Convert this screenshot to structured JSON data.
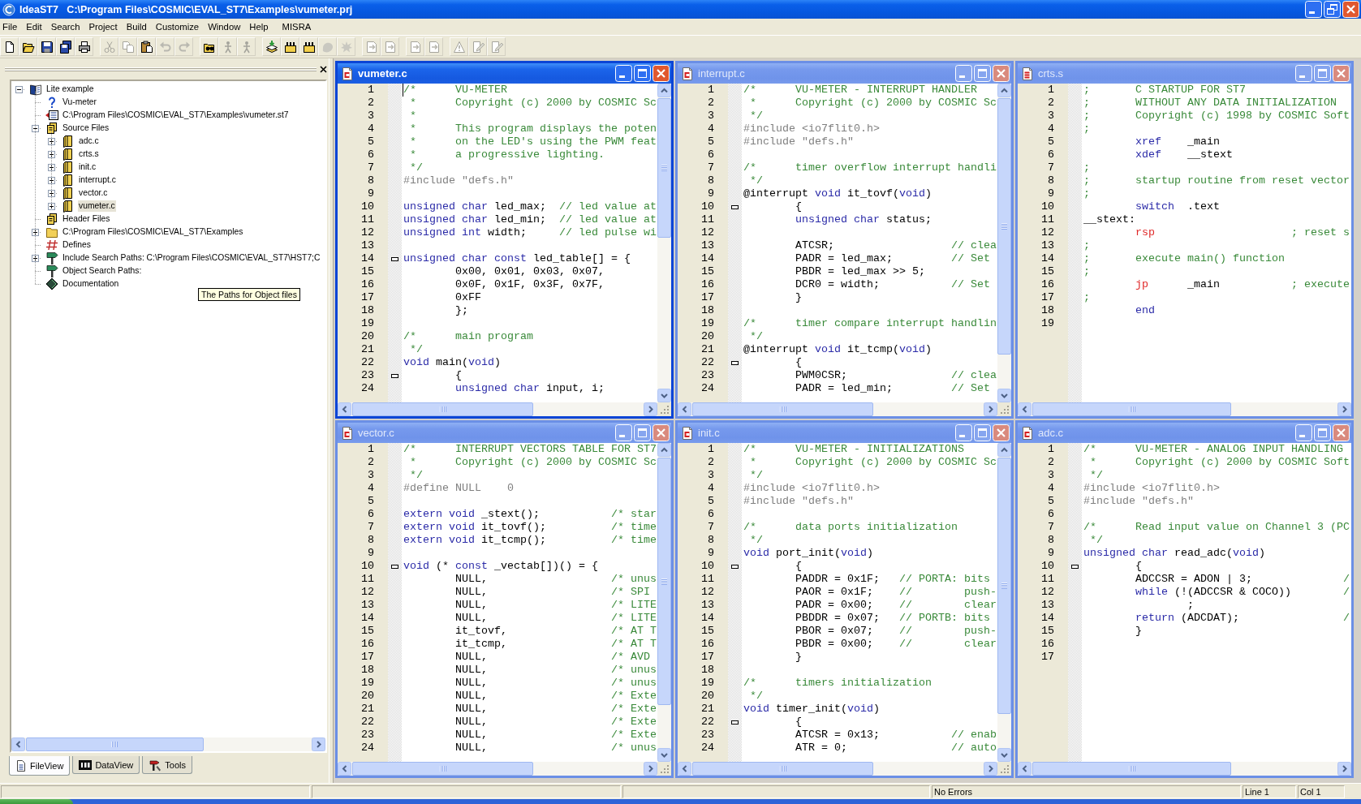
{
  "window": {
    "title": "IdeaST7   C:\\Program Files\\COSMIC\\EVAL_ST7\\Examples\\vumeter.prj"
  },
  "menu": [
    "File",
    "Edit",
    "Search",
    "Project",
    "Build",
    "Customize",
    "Window",
    "Help",
    "MISRA"
  ],
  "toolbar": [
    [
      {
        "kind": "new",
        "disabled": false
      },
      {
        "kind": "open",
        "disabled": false
      },
      {
        "kind": "save",
        "disabled": false
      },
      {
        "kind": "saveall",
        "disabled": false
      },
      {
        "kind": "print",
        "disabled": false
      }
    ],
    [
      {
        "kind": "cut",
        "disabled": true
      },
      {
        "kind": "copy",
        "disabled": true
      },
      {
        "kind": "paste",
        "disabled": false
      },
      {
        "kind": "undo",
        "disabled": true
      },
      {
        "kind": "redo",
        "disabled": true
      }
    ],
    [
      {
        "kind": "find",
        "disabled": false
      },
      {
        "kind": "figure",
        "disabled": true
      },
      {
        "kind": "figure",
        "disabled": true
      }
    ],
    [
      {
        "kind": "stack",
        "disabled": false
      },
      {
        "kind": "comb",
        "disabled": false
      },
      {
        "kind": "comb",
        "disabled": false
      },
      {
        "kind": "blob",
        "disabled": true
      },
      {
        "kind": "splat",
        "disabled": true
      }
    ],
    [
      {
        "kind": "errnav",
        "disabled": true
      },
      {
        "kind": "errnav",
        "disabled": true
      }
    ],
    [
      {
        "kind": "errnav",
        "disabled": true
      },
      {
        "kind": "errnav",
        "disabled": true
      }
    ],
    [
      {
        "kind": "triangle",
        "disabled": true
      },
      {
        "kind": "pencil",
        "disabled": true
      },
      {
        "kind": "pencil",
        "disabled": true
      }
    ]
  ],
  "workspace": {
    "tree": [
      {
        "label": "Lite example",
        "kind": "project",
        "expanded": true,
        "selected": false,
        "children": [
          {
            "label": "Vu-meter",
            "kind": "help",
            "selected": false
          },
          {
            "label": "C:\\Program Files\\COSMIC\\EVAL_ST7\\Examples\\vumeter.st7",
            "kind": "target",
            "selected": false
          },
          {
            "label": "Source Files",
            "kind": "group",
            "expanded": true,
            "selected": false,
            "children": [
              {
                "label": "adc.c",
                "kind": "source",
                "expanded": false,
                "selected": false
              },
              {
                "label": "crts.s",
                "kind": "source",
                "expanded": false,
                "selected": false
              },
              {
                "label": "init.c",
                "kind": "source",
                "expanded": false,
                "selected": false
              },
              {
                "label": "interrupt.c",
                "kind": "source",
                "expanded": false,
                "selected": false
              },
              {
                "label": "vector.c",
                "kind": "source",
                "expanded": false,
                "selected": false
              },
              {
                "label": "vumeter.c",
                "kind": "source",
                "expanded": false,
                "selected": true
              }
            ]
          },
          {
            "label": "Header Files",
            "kind": "group",
            "selected": false
          },
          {
            "label": "C:\\Program Files\\COSMIC\\EVAL_ST7\\Examples",
            "kind": "folder",
            "expanded": false,
            "selected": false
          },
          {
            "label": "Defines",
            "kind": "defines",
            "selected": false
          },
          {
            "label": "Include Search Paths: C:\\Program Files\\COSMIC\\EVAL_ST7\\HST7;C",
            "kind": "paths",
            "expanded": false,
            "selected": false
          },
          {
            "label": "Object Search Paths:",
            "kind": "paths",
            "selected": false
          },
          {
            "label": "Documentation",
            "kind": "docs",
            "selected": false
          }
        ]
      }
    ],
    "tooltip": "The Paths for Object files",
    "tabs": [
      {
        "label": "FileView",
        "kind": "file",
        "selected": true
      },
      {
        "label": "DataView",
        "kind": "data",
        "selected": false
      },
      {
        "label": "Tools",
        "kind": "tools",
        "selected": false
      }
    ]
  },
  "editors": [
    {
      "title": "vumeter.c",
      "kind": "csource",
      "active": true,
      "lines": [
        {
          "number": "1",
          "fold": false,
          "code": [
            {
              "kind": "comment",
              "text": "/*      VU-METER"
            }
          ]
        },
        {
          "number": "2",
          "fold": false,
          "code": [
            {
              "kind": "comment",
              "text": " *      Copyright (c) 2000 by COSMIC Sc"
            }
          ]
        },
        {
          "number": "3",
          "fold": false,
          "code": [
            {
              "kind": "comment",
              "text": " *"
            }
          ]
        },
        {
          "number": "4",
          "fold": false,
          "code": [
            {
              "kind": "comment",
              "text": " *      This program displays the poten"
            }
          ]
        },
        {
          "number": "5",
          "fold": false,
          "code": [
            {
              "kind": "comment",
              "text": " *      on the LED's using the PWM feat"
            }
          ]
        },
        {
          "number": "6",
          "fold": false,
          "code": [
            {
              "kind": "comment",
              "text": " *      a progressive lighting."
            }
          ]
        },
        {
          "number": "7",
          "fold": false,
          "code": [
            {
              "kind": "comment",
              "text": " */"
            }
          ]
        },
        {
          "number": "8",
          "fold": false,
          "code": [
            {
              "kind": "preprocessor",
              "text": "#include \"defs.h\""
            }
          ]
        },
        {
          "number": "9",
          "fold": false
        },
        {
          "number": "10",
          "fold": false,
          "code": [
            {
              "kind": "keyword",
              "text": "unsigned char"
            },
            {
              "kind": "plain",
              "text": " led_max;  "
            },
            {
              "kind": "comment",
              "text": "// led value at"
            }
          ]
        },
        {
          "number": "11",
          "fold": false,
          "code": [
            {
              "kind": "keyword",
              "text": "unsigned char"
            },
            {
              "kind": "plain",
              "text": " led_min;  "
            },
            {
              "kind": "comment",
              "text": "// led value at"
            }
          ]
        },
        {
          "number": "12",
          "fold": false,
          "code": [
            {
              "kind": "keyword",
              "text": "unsigned int"
            },
            {
              "kind": "plain",
              "text": " width;     "
            },
            {
              "kind": "comment",
              "text": "// led pulse wi"
            }
          ]
        },
        {
          "number": "13",
          "fold": false
        },
        {
          "number": "14",
          "fold": true,
          "code": [
            {
              "kind": "keyword",
              "text": "unsigned char const"
            },
            {
              "kind": "plain",
              "text": " led_table[] = {"
            }
          ]
        },
        {
          "number": "15",
          "fold": false,
          "code": [
            {
              "kind": "plain",
              "text": "        0x00, 0x01, 0x03, 0x07,"
            }
          ]
        },
        {
          "number": "16",
          "fold": false,
          "code": [
            {
              "kind": "plain",
              "text": "        0x0F, 0x1F, 0x3F, 0x7F,"
            }
          ]
        },
        {
          "number": "17",
          "fold": false,
          "code": [
            {
              "kind": "plain",
              "text": "        0xFF"
            }
          ]
        },
        {
          "number": "18",
          "fold": false,
          "code": [
            {
              "kind": "plain",
              "text": "        };"
            }
          ]
        },
        {
          "number": "19",
          "fold": false
        },
        {
          "number": "20",
          "fold": false,
          "code": [
            {
              "kind": "comment",
              "text": "/*      main program"
            }
          ]
        },
        {
          "number": "21",
          "fold": false,
          "code": [
            {
              "kind": "comment",
              "text": " */"
            }
          ]
        },
        {
          "number": "22",
          "fold": false,
          "code": [
            {
              "kind": "keyword",
              "text": "void"
            },
            {
              "kind": "plain",
              "text": " main("
            },
            {
              "kind": "keyword",
              "text": "void"
            },
            {
              "kind": "plain",
              "text": ")"
            }
          ]
        },
        {
          "number": "23",
          "fold": true,
          "code": [
            {
              "kind": "plain",
              "text": "        {"
            }
          ]
        },
        {
          "number": "24",
          "fold": false,
          "code": [
            {
              "kind": "keyword",
              "text": "        unsigned char"
            },
            {
              "kind": "plain",
              "text": " input, i;"
            }
          ]
        }
      ]
    },
    {
      "title": "interrupt.c",
      "kind": "csource",
      "active": false,
      "lines": [
        {
          "number": "1",
          "fold": false,
          "code": [
            {
              "kind": "comment",
              "text": "/*      VU-METER - INTERRUPT HANDLER"
            }
          ]
        },
        {
          "number": "2",
          "fold": false,
          "code": [
            {
              "kind": "comment",
              "text": " *      Copyright (c) 2000 by COSMIC Sc"
            }
          ]
        },
        {
          "number": "3",
          "fold": false,
          "code": [
            {
              "kind": "comment",
              "text": " */"
            }
          ]
        },
        {
          "number": "4",
          "fold": false,
          "code": [
            {
              "kind": "preprocessor",
              "text": "#include <io7flit0.h>"
            }
          ]
        },
        {
          "number": "5",
          "fold": false,
          "code": [
            {
              "kind": "preprocessor",
              "text": "#include \"defs.h\""
            }
          ]
        },
        {
          "number": "6",
          "fold": false
        },
        {
          "number": "7",
          "fold": false,
          "code": [
            {
              "kind": "comment",
              "text": "/*      timer overflow interrupt handli"
            }
          ]
        },
        {
          "number": "8",
          "fold": false,
          "code": [
            {
              "kind": "comment",
              "text": " */"
            }
          ]
        },
        {
          "number": "9",
          "fold": false,
          "code": [
            {
              "kind": "plain",
              "text": "@interrupt "
            },
            {
              "kind": "keyword",
              "text": "void"
            },
            {
              "kind": "plain",
              "text": " it_tovf("
            },
            {
              "kind": "keyword",
              "text": "void"
            },
            {
              "kind": "plain",
              "text": ")"
            }
          ]
        },
        {
          "number": "10",
          "fold": true,
          "code": [
            {
              "kind": "plain",
              "text": "        {"
            }
          ]
        },
        {
          "number": "11",
          "fold": false,
          "code": [
            {
              "kind": "keyword",
              "text": "        unsigned char"
            },
            {
              "kind": "plain",
              "text": " status;"
            }
          ]
        },
        {
          "number": "12",
          "fold": false
        },
        {
          "number": "13",
          "fold": false,
          "code": [
            {
              "kind": "plain",
              "text": "        ATCSR;                  "
            },
            {
              "kind": "comment",
              "text": "// clea"
            }
          ]
        },
        {
          "number": "14",
          "fold": false,
          "code": [
            {
              "kind": "plain",
              "text": "        PADR = led_max;         "
            },
            {
              "kind": "comment",
              "text": "// Set"
            }
          ]
        },
        {
          "number": "15",
          "fold": false,
          "code": [
            {
              "kind": "plain",
              "text": "        PBDR = led_max >> 5;"
            }
          ]
        },
        {
          "number": "16",
          "fold": false,
          "code": [
            {
              "kind": "plain",
              "text": "        DCR0 = width;           "
            },
            {
              "kind": "comment",
              "text": "// Set"
            }
          ]
        },
        {
          "number": "17",
          "fold": false,
          "code": [
            {
              "kind": "plain",
              "text": "        }"
            }
          ]
        },
        {
          "number": "18",
          "fold": false
        },
        {
          "number": "19",
          "fold": false,
          "code": [
            {
              "kind": "comment",
              "text": "/*      timer compare interrupt handlin"
            }
          ]
        },
        {
          "number": "20",
          "fold": false,
          "code": [
            {
              "kind": "comment",
              "text": " */"
            }
          ]
        },
        {
          "number": "21",
          "fold": false,
          "code": [
            {
              "kind": "plain",
              "text": "@interrupt "
            },
            {
              "kind": "keyword",
              "text": "void"
            },
            {
              "kind": "plain",
              "text": " it_tcmp("
            },
            {
              "kind": "keyword",
              "text": "void"
            },
            {
              "kind": "plain",
              "text": ")"
            }
          ]
        },
        {
          "number": "22",
          "fold": true,
          "code": [
            {
              "kind": "plain",
              "text": "        {"
            }
          ]
        },
        {
          "number": "23",
          "fold": false,
          "code": [
            {
              "kind": "plain",
              "text": "        PWM0CSR;                "
            },
            {
              "kind": "comment",
              "text": "// clea"
            }
          ]
        },
        {
          "number": "24",
          "fold": false,
          "code": [
            {
              "kind": "plain",
              "text": "        PADR = led_min;         "
            },
            {
              "kind": "comment",
              "text": "// Set"
            }
          ]
        }
      ]
    },
    {
      "title": "crts.s",
      "kind": "assembly",
      "active": false,
      "lines": [
        {
          "number": "1",
          "fold": false,
          "code": [
            {
              "kind": "comment",
              "text": ";       C STARTUP FOR ST7"
            }
          ]
        },
        {
          "number": "2",
          "fold": false,
          "code": [
            {
              "kind": "comment",
              "text": ";       WITHOUT ANY DATA INITIALIZATION"
            }
          ]
        },
        {
          "number": "3",
          "fold": false,
          "code": [
            {
              "kind": "comment",
              "text": ";       Copyright (c) 1998 by COSMIC Soft"
            }
          ]
        },
        {
          "number": "4",
          "fold": false,
          "code": [
            {
              "kind": "comment",
              "text": ";"
            }
          ]
        },
        {
          "number": "5",
          "fold": false,
          "code": [
            {
              "kind": "keyword",
              "text": "        xref"
            },
            {
              "kind": "plain",
              "text": "    _main"
            }
          ]
        },
        {
          "number": "6",
          "fold": false,
          "code": [
            {
              "kind": "keyword",
              "text": "        xdef"
            },
            {
              "kind": "plain",
              "text": "    __stext"
            }
          ]
        },
        {
          "number": "7",
          "fold": false,
          "code": [
            {
              "kind": "comment",
              "text": ";"
            }
          ]
        },
        {
          "number": "8",
          "fold": false,
          "code": [
            {
              "kind": "comment",
              "text": ";       startup routine from reset vector"
            }
          ]
        },
        {
          "number": "9",
          "fold": false,
          "code": [
            {
              "kind": "comment",
              "text": ";"
            }
          ]
        },
        {
          "number": "10",
          "fold": false,
          "code": [
            {
              "kind": "keyword",
              "text": "        switch"
            },
            {
              "kind": "plain",
              "text": "  .text"
            }
          ]
        },
        {
          "number": "11",
          "fold": false,
          "code": [
            {
              "kind": "plain",
              "text": "__stext:"
            }
          ]
        },
        {
          "number": "12",
          "fold": false,
          "code": [
            {
              "kind": "instruction",
              "text": "        rsp"
            },
            {
              "kind": "comment",
              "text": "                     ; reset s"
            }
          ]
        },
        {
          "number": "13",
          "fold": false,
          "code": [
            {
              "kind": "comment",
              "text": ";"
            }
          ]
        },
        {
          "number": "14",
          "fold": false,
          "code": [
            {
              "kind": "comment",
              "text": ";       execute main() function"
            }
          ]
        },
        {
          "number": "15",
          "fold": false,
          "code": [
            {
              "kind": "comment",
              "text": ";"
            }
          ]
        },
        {
          "number": "16",
          "fold": false,
          "code": [
            {
              "kind": "instruction",
              "text": "        jp"
            },
            {
              "kind": "plain",
              "text": "      _main           "
            },
            {
              "kind": "comment",
              "text": "; execute"
            }
          ]
        },
        {
          "number": "17",
          "fold": false,
          "code": [
            {
              "kind": "comment",
              "text": ";"
            }
          ]
        },
        {
          "number": "18",
          "fold": false,
          "code": [
            {
              "kind": "keyword",
              "text": "        end"
            }
          ]
        },
        {
          "number": "19",
          "fold": false
        }
      ]
    },
    {
      "title": "vector.c",
      "kind": "csource",
      "active": false,
      "lines": [
        {
          "number": "1",
          "fold": false,
          "code": [
            {
              "kind": "comment",
              "text": "/*      INTERRUPT VECTORS TABLE FOR ST7"
            }
          ]
        },
        {
          "number": "2",
          "fold": false,
          "code": [
            {
              "kind": "comment",
              "text": " *      Copyright (c) 2000 by COSMIC Sc"
            }
          ]
        },
        {
          "number": "3",
          "fold": false,
          "code": [
            {
              "kind": "comment",
              "text": " */"
            }
          ]
        },
        {
          "number": "4",
          "fold": false,
          "code": [
            {
              "kind": "preprocessor",
              "text": "#define NULL    0"
            }
          ]
        },
        {
          "number": "5",
          "fold": false
        },
        {
          "number": "6",
          "fold": false,
          "code": [
            {
              "kind": "keyword",
              "text": "extern void"
            },
            {
              "kind": "plain",
              "text": " _stext();           "
            },
            {
              "kind": "comment",
              "text": "/* star"
            }
          ]
        },
        {
          "number": "7",
          "fold": false,
          "code": [
            {
              "kind": "keyword",
              "text": "extern void"
            },
            {
              "kind": "plain",
              "text": " it_tovf();          "
            },
            {
              "kind": "comment",
              "text": "/* time"
            }
          ]
        },
        {
          "number": "8",
          "fold": false,
          "code": [
            {
              "kind": "keyword",
              "text": "extern void"
            },
            {
              "kind": "plain",
              "text": " it_tcmp();          "
            },
            {
              "kind": "comment",
              "text": "/* time"
            }
          ]
        },
        {
          "number": "9",
          "fold": false
        },
        {
          "number": "10",
          "fold": true,
          "code": [
            {
              "kind": "keyword",
              "text": "void"
            },
            {
              "kind": "plain",
              "text": " (* "
            },
            {
              "kind": "keyword",
              "text": "const"
            },
            {
              "kind": "plain",
              "text": " _vectab[])() = {"
            }
          ]
        },
        {
          "number": "11",
          "fold": false,
          "code": [
            {
              "kind": "plain",
              "text": "        NULL,                   "
            },
            {
              "kind": "comment",
              "text": "/* unus"
            }
          ]
        },
        {
          "number": "12",
          "fold": false,
          "code": [
            {
              "kind": "plain",
              "text": "        NULL,                   "
            },
            {
              "kind": "comment",
              "text": "/* SPI"
            }
          ]
        },
        {
          "number": "13",
          "fold": false,
          "code": [
            {
              "kind": "plain",
              "text": "        NULL,                   "
            },
            {
              "kind": "comment",
              "text": "/* LITE"
            }
          ]
        },
        {
          "number": "14",
          "fold": false,
          "code": [
            {
              "kind": "plain",
              "text": "        NULL,                   "
            },
            {
              "kind": "comment",
              "text": "/* LITE"
            }
          ]
        },
        {
          "number": "15",
          "fold": false,
          "code": [
            {
              "kind": "plain",
              "text": "        it_tovf,                "
            },
            {
              "kind": "comment",
              "text": "/* AT T"
            }
          ]
        },
        {
          "number": "16",
          "fold": false,
          "code": [
            {
              "kind": "plain",
              "text": "        it_tcmp,                "
            },
            {
              "kind": "comment",
              "text": "/* AT T"
            }
          ]
        },
        {
          "number": "17",
          "fold": false,
          "code": [
            {
              "kind": "plain",
              "text": "        NULL,                   "
            },
            {
              "kind": "comment",
              "text": "/* AVD"
            }
          ]
        },
        {
          "number": "18",
          "fold": false,
          "code": [
            {
              "kind": "plain",
              "text": "        NULL,                   "
            },
            {
              "kind": "comment",
              "text": "/* unus"
            }
          ]
        },
        {
          "number": "19",
          "fold": false,
          "code": [
            {
              "kind": "plain",
              "text": "        NULL,                   "
            },
            {
              "kind": "comment",
              "text": "/* unus"
            }
          ]
        },
        {
          "number": "20",
          "fold": false,
          "code": [
            {
              "kind": "plain",
              "text": "        NULL,                   "
            },
            {
              "kind": "comment",
              "text": "/* Exte"
            }
          ]
        },
        {
          "number": "21",
          "fold": false,
          "code": [
            {
              "kind": "plain",
              "text": "        NULL,                   "
            },
            {
              "kind": "comment",
              "text": "/* Exte"
            }
          ]
        },
        {
          "number": "22",
          "fold": false,
          "code": [
            {
              "kind": "plain",
              "text": "        NULL,                   "
            },
            {
              "kind": "comment",
              "text": "/* Exte"
            }
          ]
        },
        {
          "number": "23",
          "fold": false,
          "code": [
            {
              "kind": "plain",
              "text": "        NULL,                   "
            },
            {
              "kind": "comment",
              "text": "/* Exte"
            }
          ]
        },
        {
          "number": "24",
          "fold": false,
          "code": [
            {
              "kind": "plain",
              "text": "        NULL,                   "
            },
            {
              "kind": "comment",
              "text": "/* unus"
            }
          ]
        }
      ]
    },
    {
      "title": "init.c",
      "kind": "csource",
      "active": false,
      "lines": [
        {
          "number": "1",
          "fold": false,
          "code": [
            {
              "kind": "comment",
              "text": "/*      VU-METER - INITIALIZATIONS"
            }
          ]
        },
        {
          "number": "2",
          "fold": false,
          "code": [
            {
              "kind": "comment",
              "text": " *      Copyright (c) 2000 by COSMIC Sc"
            }
          ]
        },
        {
          "number": "3",
          "fold": false,
          "code": [
            {
              "kind": "comment",
              "text": " */"
            }
          ]
        },
        {
          "number": "4",
          "fold": false,
          "code": [
            {
              "kind": "preprocessor",
              "text": "#include <io7flit0.h>"
            }
          ]
        },
        {
          "number": "5",
          "fold": false,
          "code": [
            {
              "kind": "preprocessor",
              "text": "#include \"defs.h\""
            }
          ]
        },
        {
          "number": "6",
          "fold": false
        },
        {
          "number": "7",
          "fold": false,
          "code": [
            {
              "kind": "comment",
              "text": "/*      data ports initialization"
            }
          ]
        },
        {
          "number": "8",
          "fold": false,
          "code": [
            {
              "kind": "comment",
              "text": " */"
            }
          ]
        },
        {
          "number": "9",
          "fold": false,
          "code": [
            {
              "kind": "keyword",
              "text": "void"
            },
            {
              "kind": "plain",
              "text": " port_init("
            },
            {
              "kind": "keyword",
              "text": "void"
            },
            {
              "kind": "plain",
              "text": ")"
            }
          ]
        },
        {
          "number": "10",
          "fold": true,
          "code": [
            {
              "kind": "plain",
              "text": "        {"
            }
          ]
        },
        {
          "number": "11",
          "fold": false,
          "code": [
            {
              "kind": "plain",
              "text": "        PADDR = 0x1F;   "
            },
            {
              "kind": "comment",
              "text": "// PORTA: bits"
            }
          ]
        },
        {
          "number": "12",
          "fold": false,
          "code": [
            {
              "kind": "plain",
              "text": "        PAOR = 0x1F;    "
            },
            {
              "kind": "comment",
              "text": "//        push-"
            }
          ]
        },
        {
          "number": "13",
          "fold": false,
          "code": [
            {
              "kind": "plain",
              "text": "        PADR = 0x00;    "
            },
            {
              "kind": "comment",
              "text": "//        clear"
            }
          ]
        },
        {
          "number": "14",
          "fold": false,
          "code": [
            {
              "kind": "plain",
              "text": "        PBDDR = 0x07;   "
            },
            {
              "kind": "comment",
              "text": "// PORTB: bits"
            }
          ]
        },
        {
          "number": "15",
          "fold": false,
          "code": [
            {
              "kind": "plain",
              "text": "        PBOR = 0x07;    "
            },
            {
              "kind": "comment",
              "text": "//        push-"
            }
          ]
        },
        {
          "number": "16",
          "fold": false,
          "code": [
            {
              "kind": "plain",
              "text": "        PBDR = 0x00;    "
            },
            {
              "kind": "comment",
              "text": "//        clear"
            }
          ]
        },
        {
          "number": "17",
          "fold": false,
          "code": [
            {
              "kind": "plain",
              "text": "        }"
            }
          ]
        },
        {
          "number": "18",
          "fold": false
        },
        {
          "number": "19",
          "fold": false,
          "code": [
            {
              "kind": "comment",
              "text": "/*      timers initialization"
            }
          ]
        },
        {
          "number": "20",
          "fold": false,
          "code": [
            {
              "kind": "comment",
              "text": " */"
            }
          ]
        },
        {
          "number": "21",
          "fold": false,
          "code": [
            {
              "kind": "keyword",
              "text": "void"
            },
            {
              "kind": "plain",
              "text": " timer_init("
            },
            {
              "kind": "keyword",
              "text": "void"
            },
            {
              "kind": "plain",
              "text": ")"
            }
          ]
        },
        {
          "number": "22",
          "fold": true,
          "code": [
            {
              "kind": "plain",
              "text": "        {"
            }
          ]
        },
        {
          "number": "23",
          "fold": false,
          "code": [
            {
              "kind": "plain",
              "text": "        ATCSR = 0x13;           "
            },
            {
              "kind": "comment",
              "text": "// enab"
            }
          ]
        },
        {
          "number": "24",
          "fold": false,
          "code": [
            {
              "kind": "plain",
              "text": "        ATR = 0;                "
            },
            {
              "kind": "comment",
              "text": "// auto"
            }
          ]
        }
      ]
    },
    {
      "title": "adc.c",
      "kind": "csource",
      "active": false,
      "lines": [
        {
          "number": "1",
          "fold": false,
          "code": [
            {
              "kind": "comment",
              "text": "/*      VU-METER - ANALOG INPUT HANDLING"
            }
          ]
        },
        {
          "number": "2",
          "fold": false,
          "code": [
            {
              "kind": "comment",
              "text": " *      Copyright (c) 2000 by COSMIC Soft"
            }
          ]
        },
        {
          "number": "3",
          "fold": false,
          "code": [
            {
              "kind": "comment",
              "text": " */"
            }
          ]
        },
        {
          "number": "4",
          "fold": false,
          "code": [
            {
              "kind": "preprocessor",
              "text": "#include <io7flit0.h>"
            }
          ]
        },
        {
          "number": "5",
          "fold": false,
          "code": [
            {
              "kind": "preprocessor",
              "text": "#include \"defs.h\""
            }
          ]
        },
        {
          "number": "6",
          "fold": false
        },
        {
          "number": "7",
          "fold": false,
          "code": [
            {
              "kind": "comment",
              "text": "/*      Read input value on Channel 3 (PC"
            }
          ]
        },
        {
          "number": "8",
          "fold": false,
          "code": [
            {
              "kind": "comment",
              "text": " */"
            }
          ]
        },
        {
          "number": "9",
          "fold": false,
          "code": [
            {
              "kind": "keyword",
              "text": "unsigned char"
            },
            {
              "kind": "plain",
              "text": " read_adc("
            },
            {
              "kind": "keyword",
              "text": "void"
            },
            {
              "kind": "plain",
              "text": ")"
            }
          ]
        },
        {
          "number": "10",
          "fold": true,
          "code": [
            {
              "kind": "plain",
              "text": "        {"
            }
          ]
        },
        {
          "number": "11",
          "fold": false,
          "code": [
            {
              "kind": "plain",
              "text": "        ADCCSR = ADON | 3;              "
            },
            {
              "kind": "comment",
              "text": "/"
            }
          ]
        },
        {
          "number": "12",
          "fold": false,
          "code": [
            {
              "kind": "keyword",
              "text": "        while"
            },
            {
              "kind": "plain",
              "text": " (!(ADCCSR & COCO))        "
            },
            {
              "kind": "comment",
              "text": "/"
            }
          ]
        },
        {
          "number": "13",
          "fold": false,
          "code": [
            {
              "kind": "plain",
              "text": "                ;"
            }
          ]
        },
        {
          "number": "14",
          "fold": false,
          "code": [
            {
              "kind": "keyword",
              "text": "        return"
            },
            {
              "kind": "plain",
              "text": " (ADCDAT);                "
            },
            {
              "kind": "comment",
              "text": "/"
            }
          ]
        },
        {
          "number": "15",
          "fold": false,
          "code": [
            {
              "kind": "plain",
              "text": "        }"
            }
          ]
        },
        {
          "number": "16",
          "fold": false
        },
        {
          "number": "17",
          "fold": false
        }
      ]
    }
  ],
  "status_bar": [
    "No Errors",
    "Line 1",
    "Col 1"
  ]
}
